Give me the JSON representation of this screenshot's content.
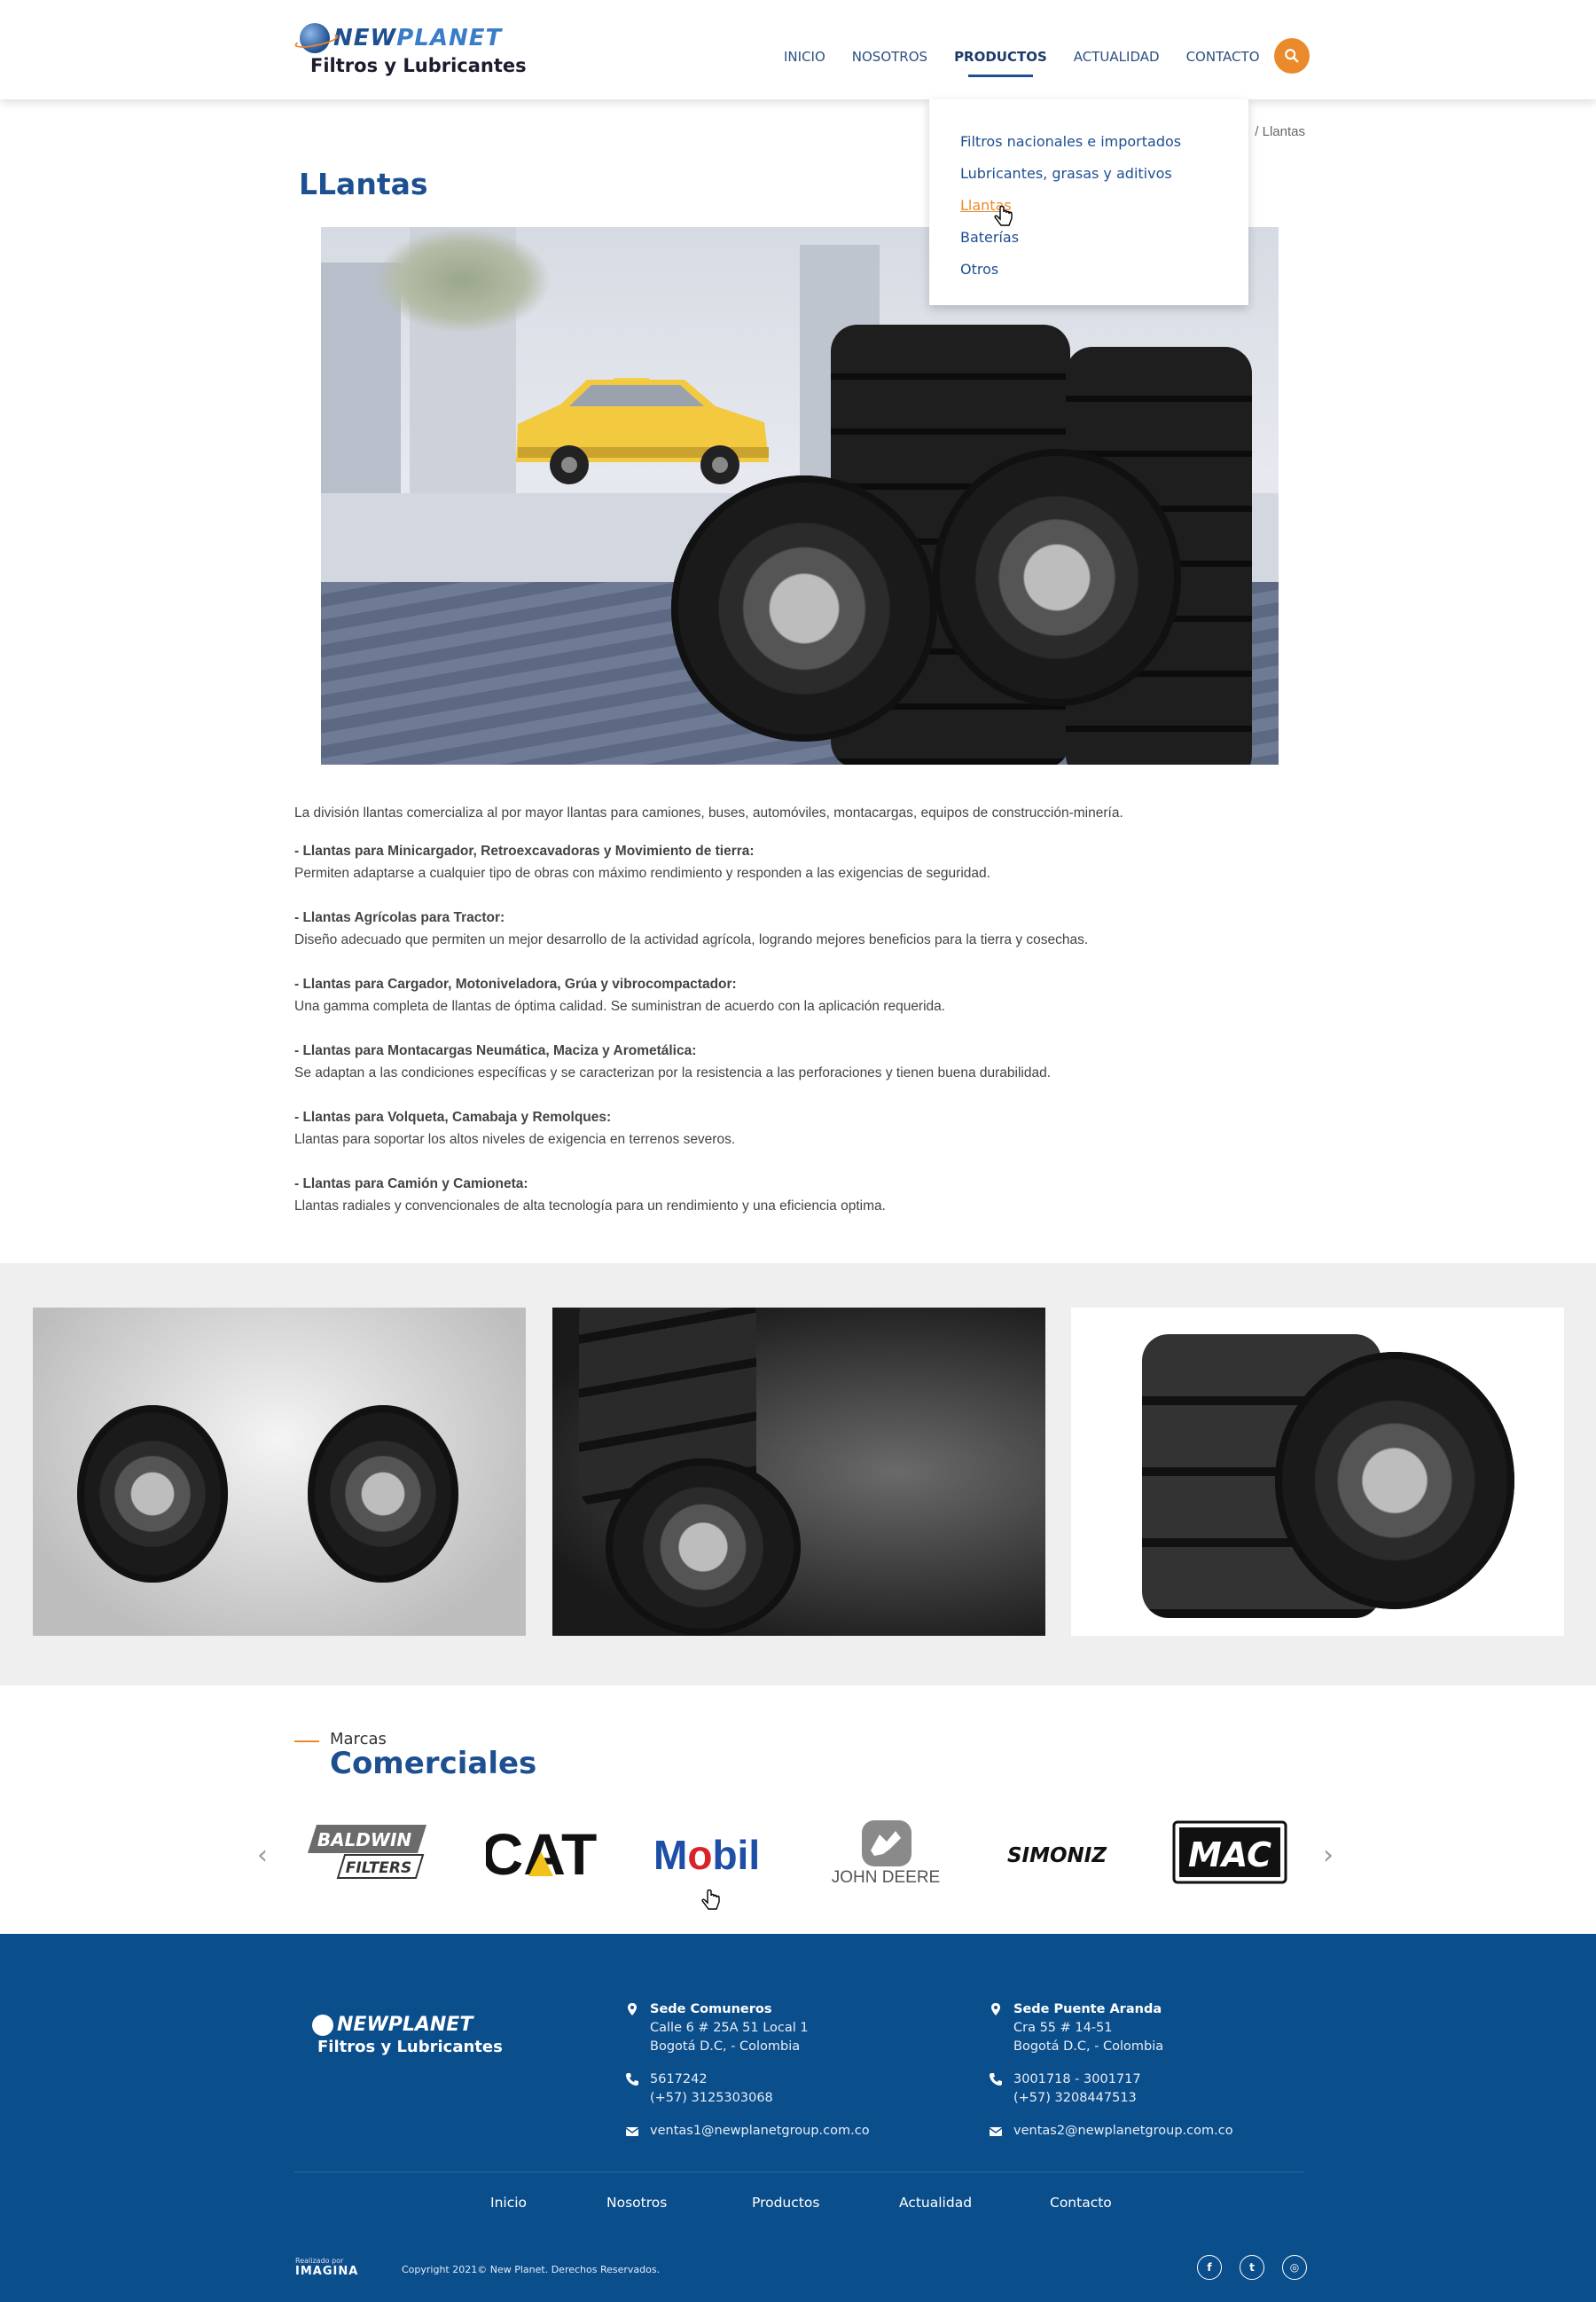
{
  "header": {
    "logo_name_new": "NEW",
    "logo_name_planet": "PLANET",
    "logo_subtitle": "Filtros y Lubricantes",
    "nav": [
      "INICIO",
      "NOSOTROS",
      "PRODUCTOS",
      "ACTUALIDAD",
      "CONTACTO"
    ],
    "active_nav": "PRODUCTOS",
    "search_icon": "search-icon"
  },
  "dropdown": {
    "items": [
      "Filtros nacionales e importados",
      "Lubricantes, grasas y aditivos",
      "Llantas",
      "Baterías",
      "Otros"
    ],
    "active": "Llantas"
  },
  "breadcrumb": "/ Llantas",
  "page_title": "LLantas",
  "content": {
    "intro": "La división llantas comercializa al por mayor llantas para camiones, buses, automóviles, montacargas, equipos de construcción-minería.",
    "features": [
      {
        "title": "- Llantas para Minicargador, Retroexcavadoras y Movimiento de tierra:",
        "text": "Permiten adaptarse a cualquier tipo de obras con máximo rendimiento y responden a las exigencias de seguridad."
      },
      {
        "title": "- Llantas Agrícolas para Tractor:",
        "text": "Diseño adecuado que permiten un mejor desarrollo de la actividad agrícola, logrando mejores beneficios para la tierra y cosechas."
      },
      {
        "title": "- Llantas para Cargador, Motoniveladora, Grúa y vibrocompactador:",
        "text": "Una gamma completa de llantas  de óptima calidad. Se suministran de acuerdo con la aplicación requerida."
      },
      {
        "title": "- Llantas para Montacargas Neumática, Maciza y Arometálica:",
        "text": "Se adaptan a las condiciones específicas y se caracterizan por la  resistencia a las perforaciones y tienen  buena durabilidad."
      },
      {
        "title": "- Llantas para Volqueta, Camabaja y Remolques:",
        "text": "Llantas para soportar los altos niveles de exigencia en terrenos severos."
      },
      {
        "title": "- Llantas para Camión y Camioneta:",
        "text": "Llantas radiales y convencionales de alta tecnología para un rendimiento y una eficiencia optima."
      }
    ]
  },
  "brands": {
    "small_title": "Marcas",
    "big_title": "Comerciales",
    "items": {
      "baldwin_1": "BALDWIN",
      "baldwin_2": "FILTERS",
      "cat": "CAT",
      "mobil_m": "M",
      "mobil_o": "o",
      "mobil_rest": "bil",
      "deere": "JOHN DEERE",
      "simoniz": "SIMONIZ",
      "mac": "MAC"
    },
    "prev_arrow": "‹",
    "next_arrow": "›"
  },
  "footer": {
    "logo_name": "NEWPLANET",
    "logo_subtitle": "Filtros y Lubricantes",
    "col1": {
      "title": "Sede Comuneros",
      "address1": "Calle 6 # 25A 51 Local 1",
      "address2": "Bogotá D.C, - Colombia",
      "phone1": "5617242",
      "phone2": "(+57) 3125303068",
      "email": "ventas1@newplanetgroup.com.co"
    },
    "col2": {
      "title": "Sede Puente Aranda",
      "address1": "Cra 55 # 14-51",
      "address2": "Bogotá D.C, - Colombia",
      "phone1": "3001718 - 3001717",
      "phone2": "(+57) 3208447513",
      "email": "ventas2@newplanetgroup.com.co"
    },
    "nav": [
      "Inicio",
      "Nosotros",
      "Productos",
      "Actualidad",
      "Contacto"
    ],
    "made_by_small": "Realizado por",
    "made_by_brand": "IMAGINA",
    "copyright": "Copyright 2021© New Planet. Derechos Reservados.",
    "social": [
      "f",
      "t",
      "◎"
    ]
  },
  "colors": {
    "brand_blue": "#1d4f91",
    "accent_orange": "#ea8a2c",
    "footer_blue": "#0b4e8c"
  }
}
